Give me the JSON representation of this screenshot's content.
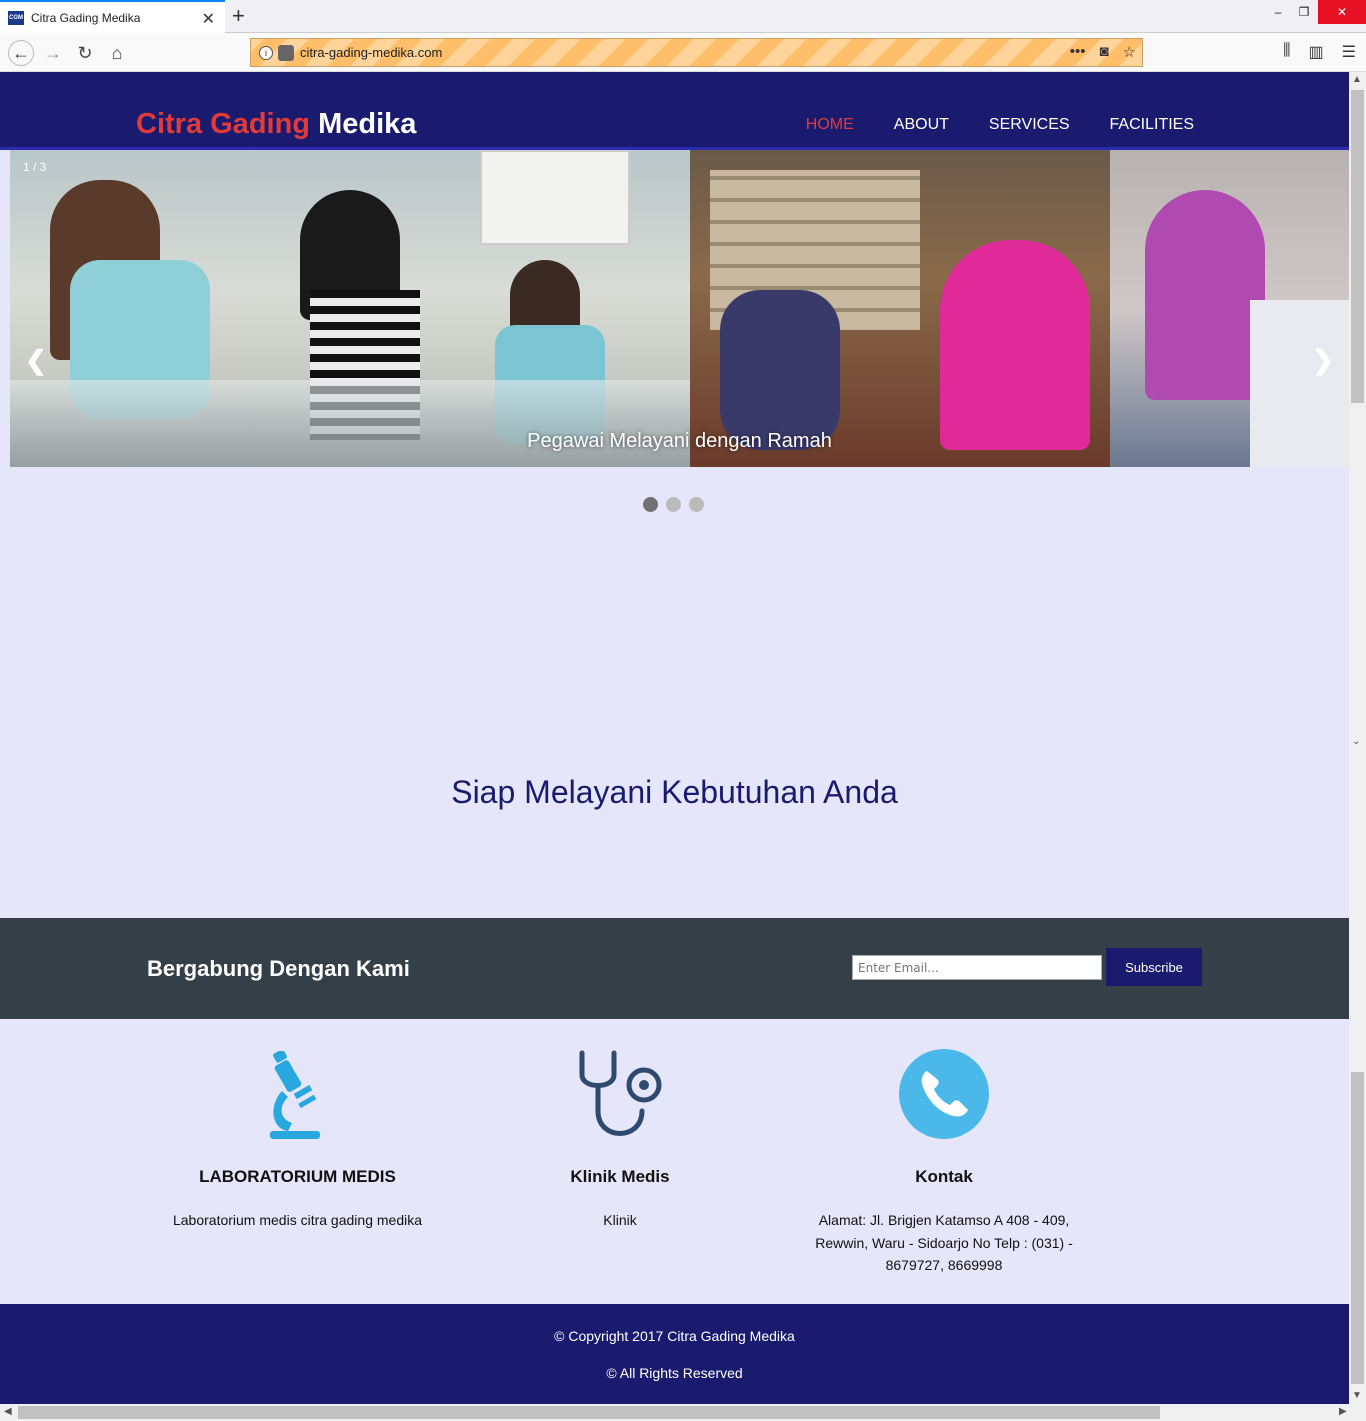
{
  "browser": {
    "tab_title": "Citra Gading Medika",
    "tab_favicon": "CGM",
    "url": "citra-gading-medika.com",
    "new_tab": "+",
    "win_minimize": "–",
    "win_restore": "❐",
    "win_close": "✕"
  },
  "header": {
    "logo_part1": "Citra Gading",
    "logo_part2": "Medika",
    "nav": [
      "HOME",
      "ABOUT",
      "SERVICES",
      "FACILITIES"
    ],
    "active_nav": "HOME"
  },
  "slider": {
    "counter": "1 / 3",
    "caption": "Pegawai Melayani dengan Ramah",
    "prev": "❮",
    "next": "❯",
    "active_dot": 0,
    "dot_count": 3
  },
  "tagline": "Siap Melayani Kebutuhan Anda",
  "join": {
    "title": "Bergabung Dengan Kami",
    "email_placeholder": "Enter Email...",
    "subscribe_label": "Subscribe"
  },
  "features": [
    {
      "icon": "microscope-icon",
      "title": "LABORATORIUM MEDIS",
      "text": "Laboratorium medis citra gading medika"
    },
    {
      "icon": "stethoscope-icon",
      "title": "Klinik Medis",
      "text": "Klinik"
    },
    {
      "icon": "phone-icon",
      "title": "Kontak",
      "text": "Alamat: Jl. Brigjen Katamso A 408 - 409, Rewwin, Waru - Sidoarjo No Telp : (031) - 8679727, 8669998"
    }
  ],
  "footer": {
    "copyright": "© Copyright 2017 Citra Gading Medika",
    "rights": "© All Rights Reserved"
  },
  "colors": {
    "brand_navy": "#1a1a6e",
    "accent_red": "#e03a3a",
    "page_bg": "#e6e6fa",
    "join_bg": "#343f48",
    "icon_blue": "#29a8e0"
  }
}
